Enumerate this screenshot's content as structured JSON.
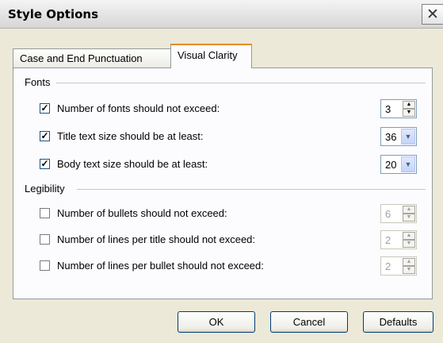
{
  "window": {
    "title": "Style Options",
    "close_glyph": "✕"
  },
  "tabs": [
    {
      "label": "Case and End Punctuation",
      "active": false
    },
    {
      "label": "Visual Clarity",
      "active": true
    }
  ],
  "fonts_group": {
    "label": "Fonts",
    "rows": [
      {
        "label": "Number of fonts should not exceed:",
        "checked": true,
        "value": "3",
        "control": "spinner",
        "enabled": true
      },
      {
        "label": "Title text size should be at least:",
        "checked": true,
        "value": "36",
        "control": "dropdown",
        "enabled": true
      },
      {
        "label": "Body text size should be at least:",
        "checked": true,
        "value": "20",
        "control": "dropdown",
        "enabled": true
      }
    ]
  },
  "legibility_group": {
    "label": "Legibility",
    "rows": [
      {
        "label": "Number of bullets should not exceed:",
        "checked": false,
        "value": "6",
        "control": "spinner",
        "enabled": false
      },
      {
        "label": "Number of lines per title should not exceed:",
        "checked": false,
        "value": "2",
        "control": "spinner",
        "enabled": false
      },
      {
        "label": "Number of lines per bullet should not exceed:",
        "checked": false,
        "value": "2",
        "control": "spinner",
        "enabled": false
      }
    ]
  },
  "buttons": {
    "ok": "OK",
    "cancel": "Cancel",
    "defaults": "Defaults"
  },
  "glyphs": {
    "check": "✓",
    "spin_up": "▲",
    "spin_down": "▼",
    "dropdown": "▼"
  }
}
